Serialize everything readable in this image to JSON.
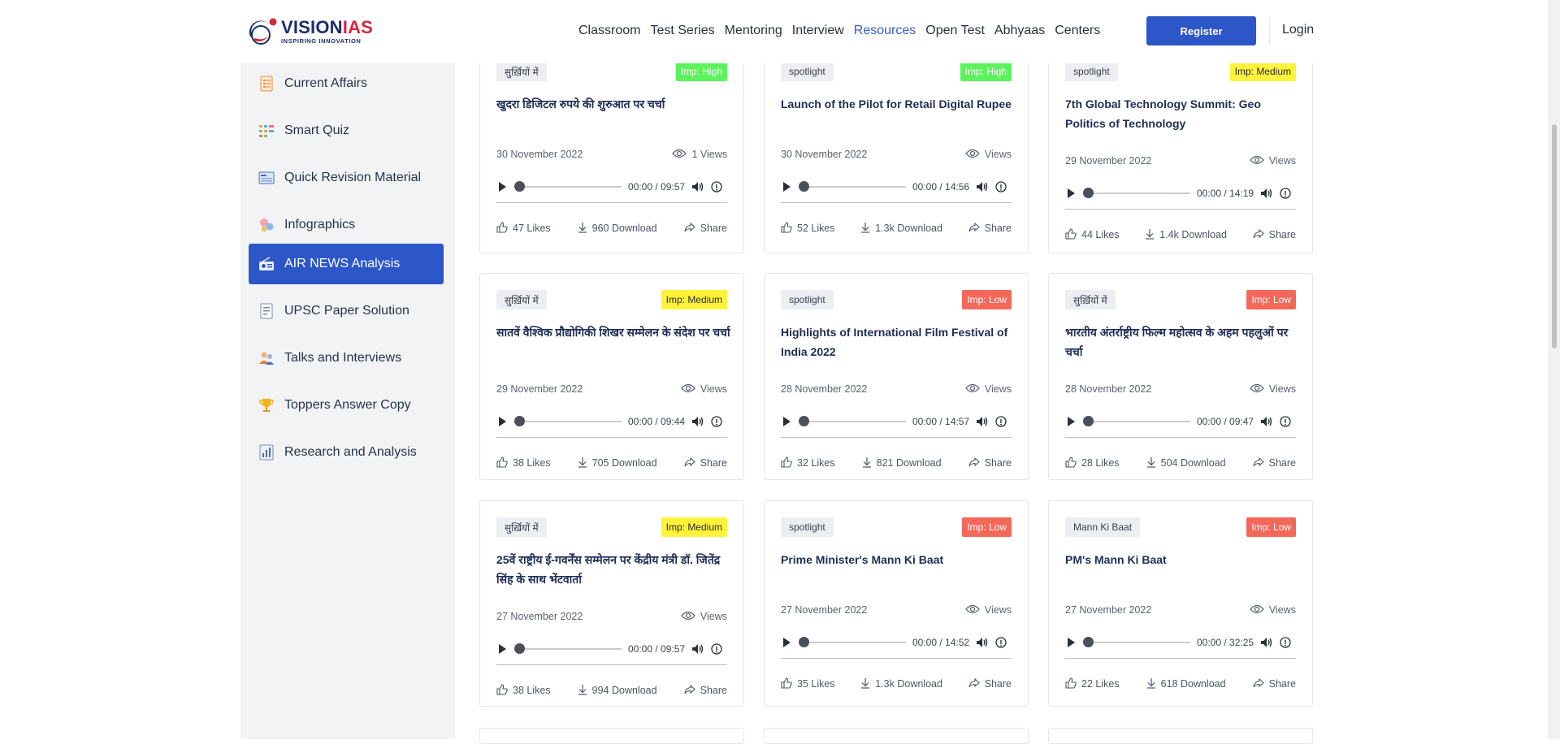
{
  "brand": {
    "name_part1": "VISION",
    "name_part2": "IAS",
    "tagline": "INSPIRING INNOVATION"
  },
  "nav": {
    "items": [
      "Classroom",
      "Test Series",
      "Mentoring",
      "Interview",
      "Resources",
      "Open Test",
      "Abhyaas",
      "Centers"
    ],
    "active": "Resources",
    "register_label": "Register",
    "login_label": "Login"
  },
  "sidebar": {
    "items": [
      {
        "label": "Current Affairs",
        "icon": "document-list-icon"
      },
      {
        "label": "Smart Quiz",
        "icon": "quiz-grid-icon"
      },
      {
        "label": "Quick Revision Material",
        "icon": "notes-icon"
      },
      {
        "label": "Infographics",
        "icon": "bubbles-icon"
      },
      {
        "label": "AIR NEWS Analysis",
        "icon": "radio-icon",
        "active": true
      },
      {
        "label": "UPSC Paper Solution",
        "icon": "paper-icon"
      },
      {
        "label": "Talks and Interviews",
        "icon": "people-icon"
      },
      {
        "label": "Toppers Answer Copy",
        "icon": "trophy-icon"
      },
      {
        "label": "Research and Analysis",
        "icon": "bar-chart-icon"
      }
    ]
  },
  "colors": {
    "accent": "#2d56c9",
    "imp_high": "#5cf25c",
    "imp_medium": "#fff23a",
    "imp_low": "#f4685a"
  },
  "cards": [
    {
      "tag": "सुर्ख़ियों में",
      "importance": "Imp: High",
      "level": "high",
      "title": "खुदरा डिजिटल रुपये की शुरुआत पर चर्चा",
      "date": "30 November 2022",
      "views": "1 Views",
      "time": "00:00 / 09:57",
      "likes": "47 Likes",
      "downloads": "960 Download",
      "share": "Share"
    },
    {
      "tag": "spotlight",
      "importance": "Imp: High",
      "level": "high",
      "title": "Launch of the Pilot for Retail Digital Rupee",
      "date": "30 November 2022",
      "views": "Views",
      "time": "00:00 / 14:56",
      "likes": "52 Likes",
      "downloads": "1.3k Download",
      "share": "Share"
    },
    {
      "tag": "spotlight",
      "importance": "Imp: Medium",
      "level": "medium",
      "title": "7th Global Technology Summit: Geo Politics of Technology",
      "date": "29 November 2022",
      "views": "Views",
      "time": "00:00 / 14:19",
      "likes": "44 Likes",
      "downloads": "1.4k Download",
      "share": "Share"
    },
    {
      "tag": "सुर्ख़ियों में",
      "importance": "Imp: Medium",
      "level": "medium",
      "title": "सातवें वैश्विक प्रौद्योगिकी शिखर सम्मेलन के संदेश पर चर्चा",
      "date": "29 November 2022",
      "views": "Views",
      "time": "00:00 / 09:44",
      "likes": "38 Likes",
      "downloads": "705 Download",
      "share": "Share"
    },
    {
      "tag": "spotlight",
      "importance": "Imp: Low",
      "level": "low",
      "title": "Highlights of International Film Festival of India 2022",
      "date": "28 November 2022",
      "views": "Views",
      "time": "00:00 / 14:57",
      "likes": "32 Likes",
      "downloads": "821 Download",
      "share": "Share"
    },
    {
      "tag": "सुर्ख़ियों में",
      "importance": "Imp: Low",
      "level": "low",
      "title": "भारतीय अंतर्राष्ट्रीय फिल्म महोत्सव के अहम पहलुओं पर चर्चा",
      "date": "28 November 2022",
      "views": "Views",
      "time": "00:00 / 09:47",
      "likes": "28 Likes",
      "downloads": "504 Download",
      "share": "Share"
    },
    {
      "tag": "सुर्ख़ियों में",
      "importance": "Imp: Medium",
      "level": "medium",
      "title": "25वें राष्ट्रीय ई-गवर्नेंस सम्मेलन पर केंद्रीय मंत्री डॉ. जितेंद्र सिंह के साथ भेंटवार्ता",
      "date": "27 November 2022",
      "views": "Views",
      "time": "00:00 / 09:57",
      "likes": "38 Likes",
      "downloads": "994 Download",
      "share": "Share"
    },
    {
      "tag": "spotlight",
      "importance": "Imp: Low",
      "level": "low",
      "title": "Prime Minister's Mann Ki Baat",
      "date": "27 November 2022",
      "views": "Views",
      "time": "00:00 / 14:52",
      "likes": "35 Likes",
      "downloads": "1.3k Download",
      "share": "Share"
    },
    {
      "tag": "Mann Ki Baat",
      "importance": "Imp: Low",
      "level": "low",
      "title": "PM's Mann Ki Baat",
      "date": "27 November 2022",
      "views": "Views",
      "time": "00:00 / 32:25",
      "likes": "22 Likes",
      "downloads": "618 Download",
      "share": "Share"
    }
  ]
}
